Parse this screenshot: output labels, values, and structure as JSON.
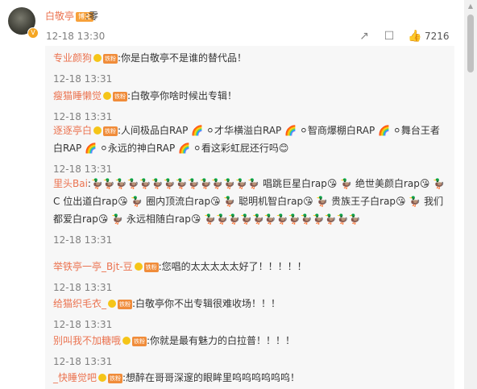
{
  "top_comment": {
    "author": "白敬亭",
    "badge": "博主",
    "text": ":零",
    "time": "12-18 13:30",
    "likes": "7216",
    "icons": [
      "share-icon",
      "comment-icon",
      "like-icon"
    ]
  },
  "replies": [
    {
      "name": "专业颜狗",
      "badge": "铁粉",
      "text": ":你是白敬亭不是谁的替代品！",
      "time": "12-18 13:31"
    },
    {
      "name": "瘦猫睡懒觉",
      "badge": "铁粉",
      "text": ":白敬亭你啥时候出专辑！",
      "time": "12-18 13:31"
    },
    {
      "name": "逐逐亭白",
      "badge": "铁粉",
      "text": ":人间极品白RAP 🌈 ⚪才华横溢白RAP 🌈 ⚪智商爆棚白RAP 🌈 ⚪舞台王者白RAP 🌈 ⚪永远的神白RAP 🌈 ⚪看这彩虹屁还行吗😊",
      "time": "12-18 13:31"
    },
    {
      "name": "里头Bai",
      "badge": "",
      "text": ":🦆🦆🦆🦆🦆🦆🦆🦆🦆🦆🦆🦆🦆🦆 唱跳巨星白rap😘 🦆 绝世美颜白rap😘 🦆 C 位出道白rap😘 🦆 圈内顶流白rap😘 🦆 聪明机智白rap😘 🦆 贵族王子白rap😘 🦆 我们都爱白rap😘 🦆 永远相随白rap😘 🦆🦆🦆🦆🦆🦆🦆🦆🦆🦆🦆🦆🦆",
      "time": "12-18 13:31"
    },
    {
      "name": "举铁亭一亭_Bjt-豆",
      "badge": "铁粉",
      "text": ":您唱的太太太太太好了！！！！！",
      "time": "12-18 13:31"
    },
    {
      "name": "给猫织毛衣_",
      "badge": "铁粉",
      "text": ":白敬亭你不出专辑很难收场！！！",
      "time": "12-18 13:31"
    },
    {
      "name": "别叫我不加糖哦",
      "badge": "铁粉",
      "text": ":你就是最有魅力的白拉普！！！！",
      "time": "12-18 13:31"
    },
    {
      "name": "_快睡觉吧",
      "badge": "铁粉",
      "text": ":想醉在哥哥深邃的眼眸里呜呜呜呜呜呜！",
      "time": ""
    }
  ]
}
